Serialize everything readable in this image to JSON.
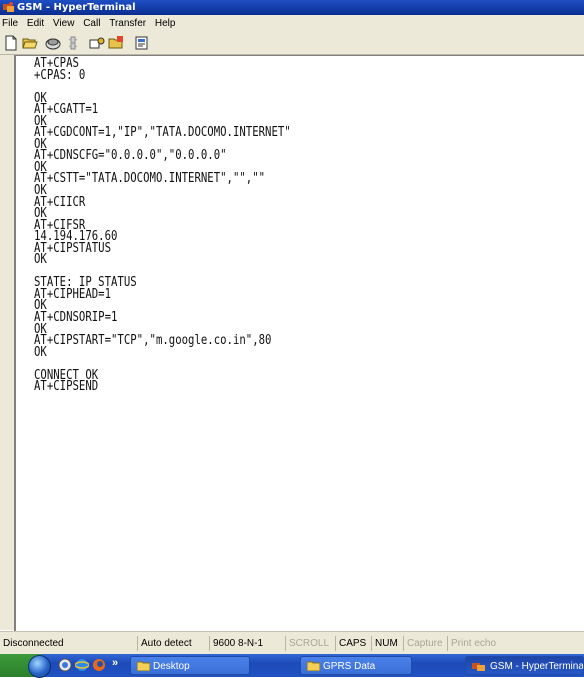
{
  "window": {
    "title": "GSM - HyperTerminal"
  },
  "menu": [
    "File",
    "Edit",
    "View",
    "Call",
    "Transfer",
    "Help"
  ],
  "toolbar": {
    "icons": [
      "new-icon",
      "open-icon",
      "connect-icon",
      "disconnect-icon",
      "send-icon",
      "receive-icon",
      "properties-icon"
    ]
  },
  "terminal": {
    "lines": [
      "AT+CPAS",
      "+CPAS: 0",
      "",
      "OK",
      "AT+CGATT=1",
      "OK",
      "AT+CGDCONT=1,\"IP\",\"TATA.DOCOMO.INTERNET\"",
      "OK",
      "AT+CDNSCFG=\"0.0.0.0\",\"0.0.0.0\"",
      "OK",
      "AT+CSTT=\"TATA.DOCOMO.INTERNET\",\"\",\"\"",
      "OK",
      "AT+CIICR",
      "OK",
      "AT+CIFSR",
      "14.194.176.60",
      "AT+CIPSTATUS",
      "OK",
      "",
      "STATE: IP STATUS",
      "AT+CIPHEAD=1",
      "OK",
      "AT+CDNSORIP=1",
      "OK",
      "AT+CIPSTART=\"TCP\",\"m.google.co.in\",80",
      "OK",
      "",
      "CONNECT OK",
      "AT+CIPSEND"
    ]
  },
  "status": {
    "connection": "Disconnected",
    "detect": "Auto detect",
    "settings": "9600 8-N-1",
    "scroll": "SCROLL",
    "caps": "CAPS",
    "num": "NUM",
    "capture": "Capture",
    "print_echo": "Print echo"
  },
  "taskbar": {
    "chevron": "»",
    "buttons": [
      "Desktop",
      "GPRS Data",
      "GSM - HyperTerminal"
    ]
  },
  "colors": {
    "titlebar": "#0a2c8f",
    "chrome": "#ece9d8",
    "taskbar": "#245edb"
  }
}
